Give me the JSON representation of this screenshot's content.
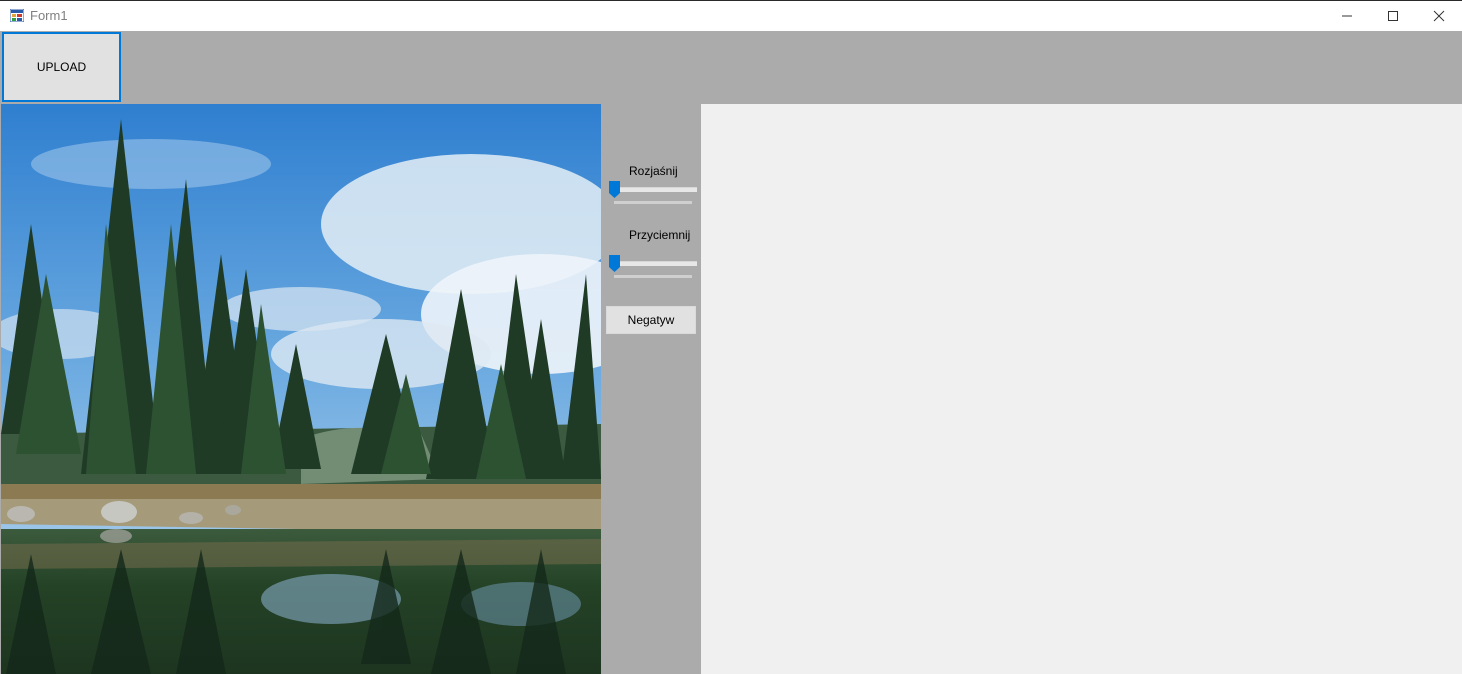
{
  "window": {
    "title": "Form1",
    "icon": "form-app-icon",
    "controls": [
      "minimize-icon",
      "maximize-icon",
      "close-icon"
    ]
  },
  "toolbar": {
    "upload_label": "UPLOAD"
  },
  "controls": {
    "brighten": {
      "label": "Rozjaśnij",
      "value": 0
    },
    "darken": {
      "label": "Przyciemnij",
      "value": 0
    },
    "negative_label": "Negatyw"
  },
  "images": {
    "original": "lake-forest-landscape",
    "result": ""
  },
  "colors": {
    "accent": "#0078d7",
    "panel_bg": "#ababab",
    "button_bg": "#e1e1e1",
    "result_bg": "#f0f0f0"
  }
}
